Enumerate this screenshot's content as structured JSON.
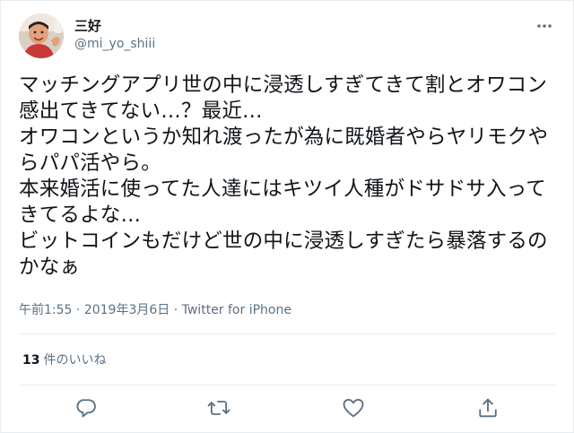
{
  "user": {
    "display_name": "三好",
    "handle": "@mi_yo_shiii"
  },
  "tweet": {
    "text": "マッチングアプリ世の中に浸透しすぎてきて割とオワコン感出てきてない…？最近…\nオワコンというか知れ渡ったが為に既婚者やらヤリモクやらパパ活やら。\n本来婚活に使ってた人達にはキツイ人種がドサドサ入ってきてるよな…\nビットコインもだけど世の中に浸透しすぎたら暴落するのかなぁ"
  },
  "meta": {
    "time": "午前1:55",
    "separator1": " · ",
    "date": "2019年3月6日",
    "separator2": " · ",
    "source": "Twitter for iPhone"
  },
  "stats": {
    "likes_count": "13",
    "likes_label": "件のいいね"
  },
  "icons": {
    "more": "more-icon",
    "reply": "reply-icon",
    "retweet": "retweet-icon",
    "like": "heart-icon",
    "share": "share-icon"
  },
  "colors": {
    "text": "#0f1419",
    "secondary": "#5b7083",
    "border": "#e6ecf0"
  }
}
